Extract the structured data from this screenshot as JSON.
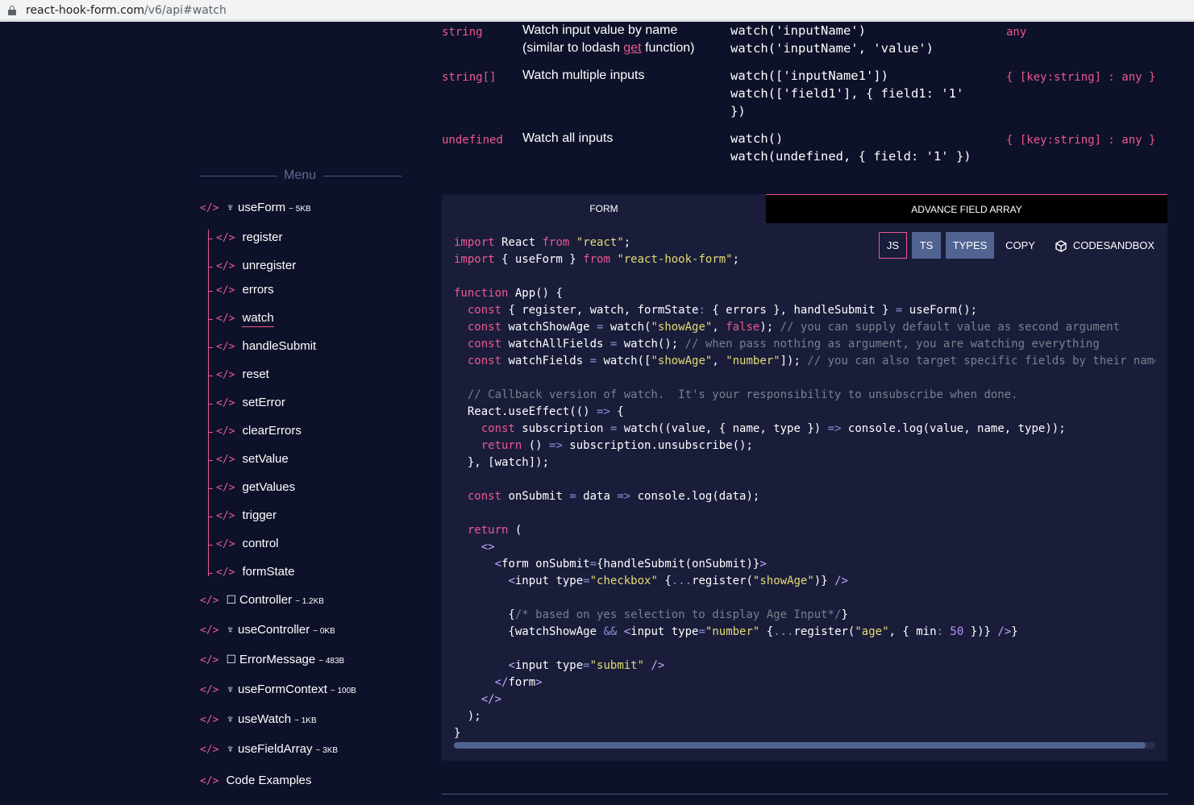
{
  "browser": {
    "url_host": "react-hook-form.com",
    "url_path": "/v6/api#watch"
  },
  "api_table": {
    "rows": [
      {
        "type": "string",
        "desc_lines": [
          "Watch input value by name",
          "(similar to lodash ",
          "get",
          " function)"
        ],
        "code": "watch('inputName')\nwatch('inputName', 'value')",
        "returns": "any"
      },
      {
        "type": "string[]",
        "desc": "Watch multiple inputs",
        "code": "watch(['inputName1'])\nwatch(['field1'], { field1: '1'\n})",
        "returns": "{ [key:string] : any }"
      },
      {
        "type": "undefined",
        "desc": "Watch all inputs",
        "code": "watch()\nwatch(undefined, { field: '1' })",
        "returns": "{ [key:string] : any }"
      }
    ]
  },
  "menu": {
    "title": "Menu",
    "tag": "</>",
    "items": [
      {
        "label": "useForm",
        "glyph": "♆",
        "size": "~ 5KB"
      },
      {
        "label": "Controller",
        "glyph": "☐",
        "size": "~ 1.2KB"
      },
      {
        "label": "useController",
        "glyph": "♆",
        "size": "~ 0KB"
      },
      {
        "label": "ErrorMessage",
        "glyph": "☐",
        "size": "~ 483B"
      },
      {
        "label": "useFormContext",
        "glyph": "♆",
        "size": "~ 100B"
      },
      {
        "label": "useWatch",
        "glyph": "♆",
        "size": "~ 1KB"
      },
      {
        "label": "useFieldArray",
        "glyph": "♆",
        "size": "~ 3KB"
      },
      {
        "label": "Code Examples",
        "glyph": "",
        "size": ""
      }
    ],
    "subitems": [
      "register",
      "unregister",
      "errors",
      "watch",
      "handleSubmit",
      "reset",
      "setError",
      "clearErrors",
      "setValue",
      "getValues",
      "trigger",
      "control",
      "formState"
    ],
    "active_subitem": "watch"
  },
  "code_panel": {
    "tabs": [
      "FORM",
      "ADVANCE FIELD ARRAY"
    ],
    "buttons": {
      "js": "JS",
      "ts": "TS",
      "types": "TYPES",
      "copy": "COPY",
      "codesandbox": "CODESANDBOX"
    },
    "scroll_fraction": 0.986
  },
  "colors": {
    "background": "#0d1129",
    "panel": "#191d3a",
    "accent": "#ec5990",
    "button": "#516391"
  }
}
